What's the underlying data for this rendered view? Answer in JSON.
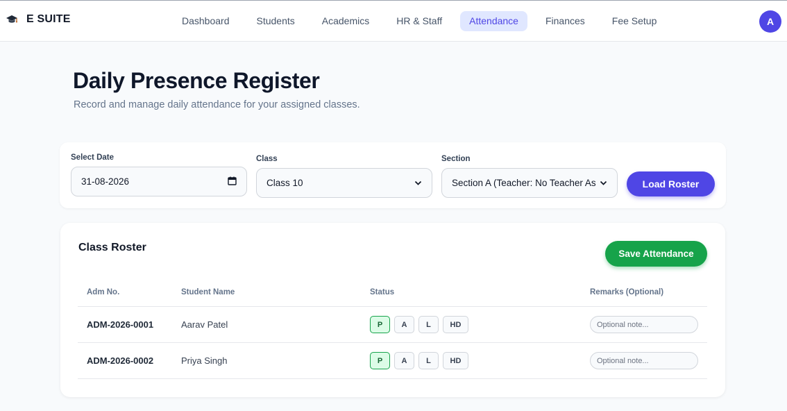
{
  "app": {
    "brand": "E SUITE",
    "avatar_initial": "A",
    "accent": "#4f46e5",
    "success": "#16a34a"
  },
  "nav": {
    "items": [
      {
        "label": "Dashboard",
        "active": false
      },
      {
        "label": "Students",
        "active": false
      },
      {
        "label": "Academics",
        "active": false
      },
      {
        "label": "HR & Staff",
        "active": false
      },
      {
        "label": "Attendance",
        "active": true
      },
      {
        "label": "Finances",
        "active": false
      },
      {
        "label": "Fee Setup",
        "active": false
      }
    ]
  },
  "page": {
    "title": "Daily Presence Register",
    "subtitle": "Record and manage daily attendance for your assigned classes."
  },
  "filters": {
    "date": {
      "label": "Select Date",
      "value": "31-08-2026",
      "icon": "calendar-icon"
    },
    "class": {
      "label": "Class",
      "value": "Class 10",
      "icon": "chevron-down-icon"
    },
    "section": {
      "label": "Section",
      "value": "Section A (Teacher: No Teacher As",
      "icon": "chevron-down-icon"
    },
    "load_label": "Load Roster"
  },
  "roster": {
    "title": "Class Roster",
    "save_label": "Save Attendance",
    "columns": {
      "adm": "Adm No.",
      "name": "Student Name",
      "status": "Status",
      "remarks": "Remarks (Optional)"
    },
    "status_options": [
      "P",
      "A",
      "L",
      "HD"
    ],
    "remarks_placeholder": "Optional note...",
    "rows": [
      {
        "adm": "ADM-2026-0001",
        "name": "Aarav Patel",
        "status": "P",
        "remark": ""
      },
      {
        "adm": "ADM-2026-0002",
        "name": "Priya Singh",
        "status": "P",
        "remark": ""
      }
    ]
  }
}
